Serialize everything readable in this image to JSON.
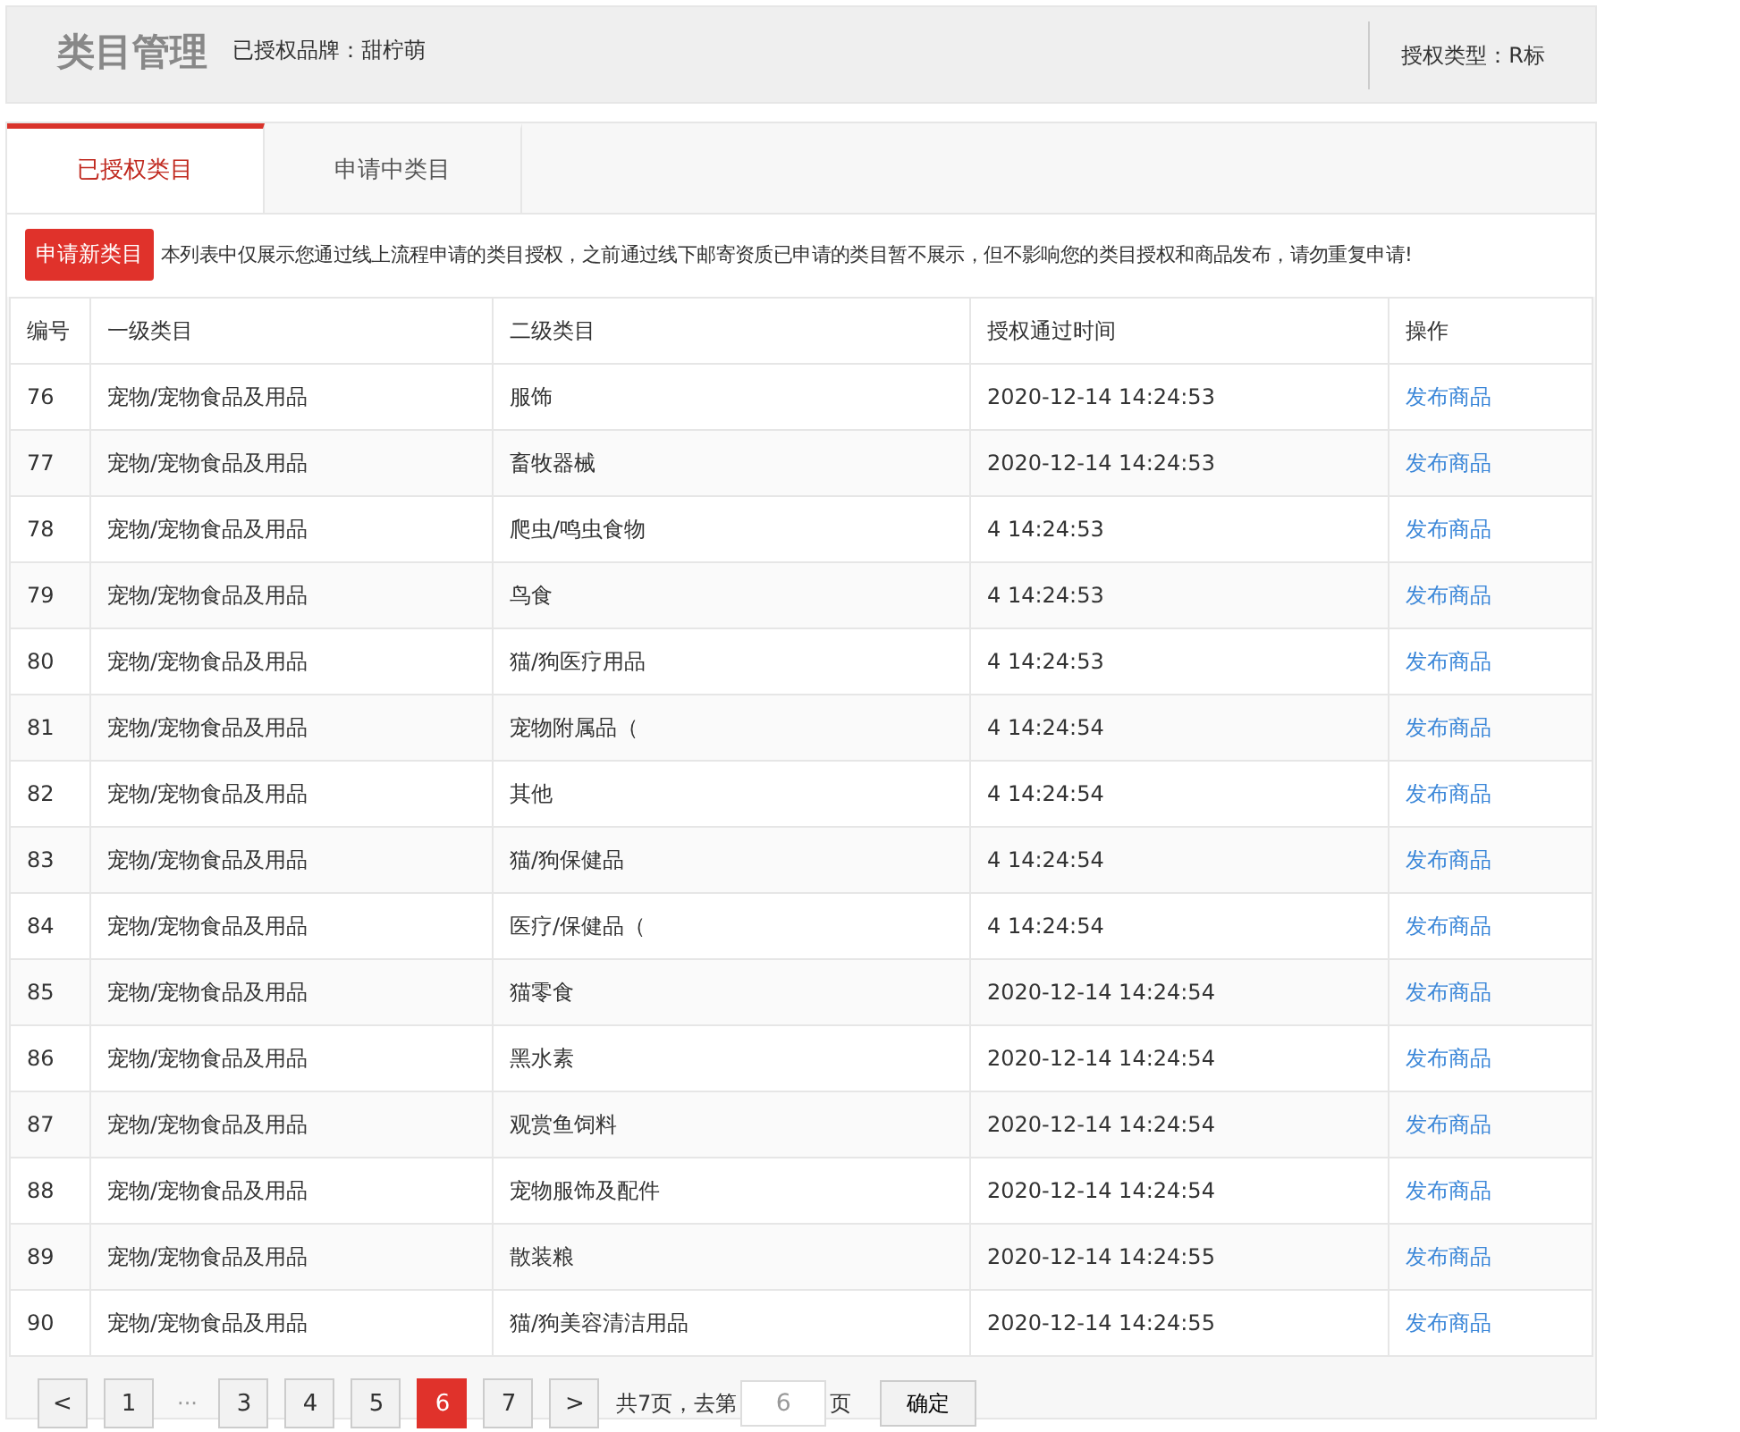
{
  "header": {
    "title": "类目管理",
    "brand_label": "已授权品牌：甜柠萌",
    "auth_type": "授权类型：R标"
  },
  "tabs": [
    {
      "label": "已授权类目",
      "selected": true
    },
    {
      "label": "申请中类目",
      "selected": false
    }
  ],
  "notice": {
    "button": "申请新类目",
    "text": "本列表中仅展示您通过线上流程申请的类目授权，之前通过线下邮寄资质已申请的类目暂不展示，但不影响您的类目授权和商品发布，请勿重复申请!"
  },
  "table": {
    "columns": [
      "编号",
      "一级类目",
      "二级类目",
      "授权通过时间",
      "操作"
    ],
    "rows": [
      [
        "76",
        "宠物/宠物食品及用品",
        "服饰",
        "2020-12-14 14:24:53",
        "发布商品"
      ],
      [
        "77",
        "宠物/宠物食品及用品",
        "畜牧器械",
        "2020-12-14 14:24:53",
        "发布商品"
      ],
      [
        "78",
        "宠物/宠物食品及用品",
        "爬虫/鸣虫食物",
        "4 14:24:53",
        "发布商品"
      ],
      [
        "79",
        "宠物/宠物食品及用品",
        "鸟食",
        "4 14:24:53",
        "发布商品"
      ],
      [
        "80",
        "宠物/宠物食品及用品",
        "猫/狗医疗用品",
        "4 14:24:53",
        "发布商品"
      ],
      [
        "81",
        "宠物/宠物食品及用品",
        "宠物附属品（",
        "4 14:24:54",
        "发布商品"
      ],
      [
        "82",
        "宠物/宠物食品及用品",
        "其他",
        "4 14:24:54",
        "发布商品"
      ],
      [
        "83",
        "宠物/宠物食品及用品",
        "猫/狗保健品",
        "4 14:24:54",
        "发布商品"
      ],
      [
        "84",
        "宠物/宠物食品及用品",
        "医疗/保健品（",
        "4 14:24:54",
        "发布商品"
      ],
      [
        "85",
        "宠物/宠物食品及用品",
        "猫零食",
        "2020-12-14 14:24:54",
        "发布商品"
      ],
      [
        "86",
        "宠物/宠物食品及用品",
        "黑水素",
        "2020-12-14 14:24:54",
        "发布商品"
      ],
      [
        "87",
        "宠物/宠物食品及用品",
        "观赏鱼饲料",
        "2020-12-14 14:24:54",
        "发布商品"
      ],
      [
        "88",
        "宠物/宠物食品及用品",
        "宠物服饰及配件",
        "2020-12-14 14:24:54",
        "发布商品"
      ],
      [
        "89",
        "宠物/宠物食品及用品",
        "散装粮",
        "2020-12-14 14:24:55",
        "发布商品"
      ],
      [
        "90",
        "宠物/宠物食品及用品",
        "猫/狗美容清洁用品",
        "2020-12-14 14:24:55",
        "发布商品"
      ]
    ]
  },
  "pagination": {
    "prev": "<",
    "pages": [
      {
        "label": "1",
        "selected": false
      },
      {
        "label": "3",
        "selected": false
      },
      {
        "label": "4",
        "selected": false
      },
      {
        "label": "5",
        "selected": false
      },
      {
        "label": "6",
        "selected": true
      },
      {
        "label": "7",
        "selected": false
      }
    ],
    "ellipsis": "···",
    "next": ">",
    "total_label": "共7页，去第",
    "page_value": "6",
    "page_suffix": "页",
    "confirm": "确定"
  }
}
